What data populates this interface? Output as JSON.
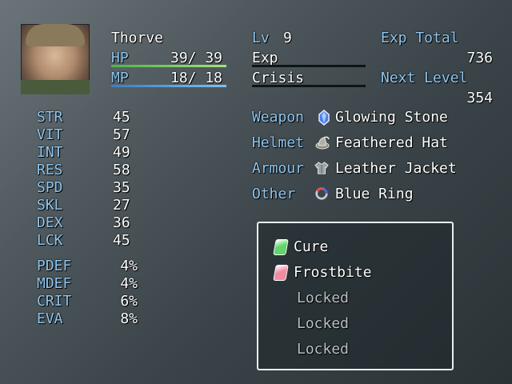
{
  "actor": {
    "name": "Thorve",
    "hp_label": "HP",
    "hp_value": "39/ 39",
    "hp_ratio": 1.0,
    "mp_label": "MP",
    "mp_value": "18/ 18",
    "mp_ratio": 1.0,
    "level_label": "Lv",
    "level": "9",
    "exp_label": "Exp",
    "crisis_label": "Crisis",
    "exp_total_label": "Exp Total",
    "exp_total": "736",
    "next_level_label": "Next Level",
    "next_level": "354"
  },
  "stats": [
    {
      "label": "STR",
      "value": "45"
    },
    {
      "label": "VIT",
      "value": "57"
    },
    {
      "label": "INT",
      "value": "49"
    },
    {
      "label": "RES",
      "value": "58"
    },
    {
      "label": "SPD",
      "value": "35"
    },
    {
      "label": "SKL",
      "value": "27"
    },
    {
      "label": "DEX",
      "value": "36"
    },
    {
      "label": "LCK",
      "value": "45"
    }
  ],
  "substats": [
    {
      "label": "PDEF",
      "value": "4%"
    },
    {
      "label": "MDEF",
      "value": "4%"
    },
    {
      "label": "CRIT",
      "value": "6%"
    },
    {
      "label": "EVA",
      "value": "8%"
    }
  ],
  "equipment": [
    {
      "slot": "Weapon",
      "item": "Glowing Stone",
      "icon": "crystal-icon"
    },
    {
      "slot": "Helmet",
      "item": "Feathered Hat",
      "icon": "hat-icon"
    },
    {
      "slot": "Armour",
      "item": "Leather Jacket",
      "icon": "jacket-icon"
    },
    {
      "slot": "Other",
      "item": "Blue Ring",
      "icon": "ring-icon"
    }
  ],
  "skills": [
    {
      "label": "Cure",
      "icon": "green-gem-icon",
      "color": "#5fd66a",
      "locked": false
    },
    {
      "label": "Frostbite",
      "icon": "pink-gem-icon",
      "color": "#f08ca0",
      "locked": false
    },
    {
      "label": "Locked",
      "icon": "",
      "color": "",
      "locked": true
    },
    {
      "label": "Locked",
      "icon": "",
      "color": "",
      "locked": true
    },
    {
      "label": "Locked",
      "icon": "",
      "color": "",
      "locked": true
    }
  ],
  "colors": {
    "system_text": "#8fc6ef",
    "hp_bar": "#7cd26a",
    "mp_bar": "#5aa9e6"
  }
}
